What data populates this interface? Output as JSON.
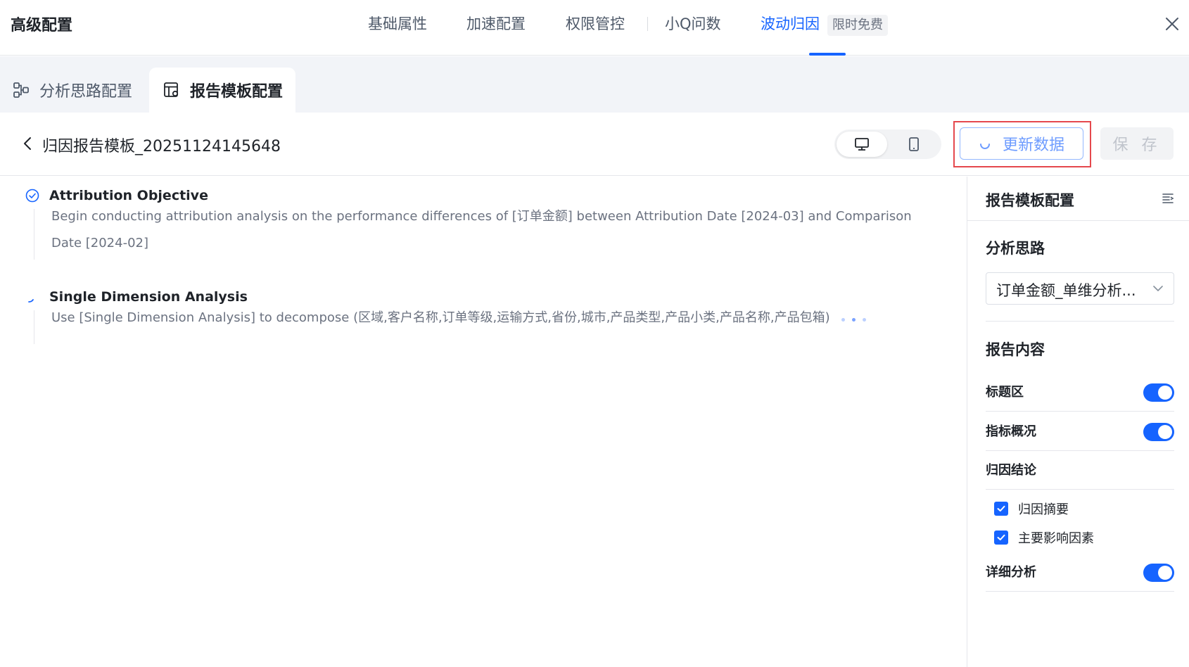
{
  "header": {
    "title": "高级配置",
    "tabs": [
      {
        "label": "基础属性"
      },
      {
        "label": "加速配置"
      },
      {
        "label": "权限管控"
      },
      {
        "label": "小Q问数"
      },
      {
        "label": "波动归因"
      }
    ],
    "free_badge": "限时免费",
    "active_tab": "波动归因"
  },
  "subtabs": [
    {
      "label": "分析思路配置",
      "icon": "flow-icon"
    },
    {
      "label": "报告模板配置",
      "icon": "template-icon"
    }
  ],
  "template": {
    "name": "归因报告模板_20251124145648",
    "update_label": "更新数据",
    "save_label": "保 存"
  },
  "steps": [
    {
      "title": "Attribution Objective",
      "status": "done",
      "desc": "Begin conducting attribution analysis on the performance differences of [订单金额] between Attribution Date [2024-03] and Comparison Date [2024-02]"
    },
    {
      "title": "Single Dimension Analysis",
      "status": "loading",
      "desc": "Use [Single Dimension Analysis] to decompose (区域,客户名称,订单等级,运输方式,省份,城市,产品类型,产品小类,产品名称,产品包箱)"
    }
  ],
  "panel": {
    "title": "报告模板配置",
    "analysis_label": "分析思路",
    "analysis_value": "订单金额_单维分析...",
    "content_label": "报告内容",
    "rows": [
      {
        "label": "标题区",
        "enabled": true
      },
      {
        "label": "指标概况",
        "enabled": true
      },
      {
        "label": "归因结论"
      },
      {
        "label": "详细分析",
        "enabled": true
      }
    ],
    "checks": [
      {
        "label": "归因摘要",
        "checked": true
      },
      {
        "label": "主要影响因素",
        "checked": true
      }
    ]
  },
  "colors": {
    "accent": "#1664ff",
    "highlight": "#e5484d"
  }
}
